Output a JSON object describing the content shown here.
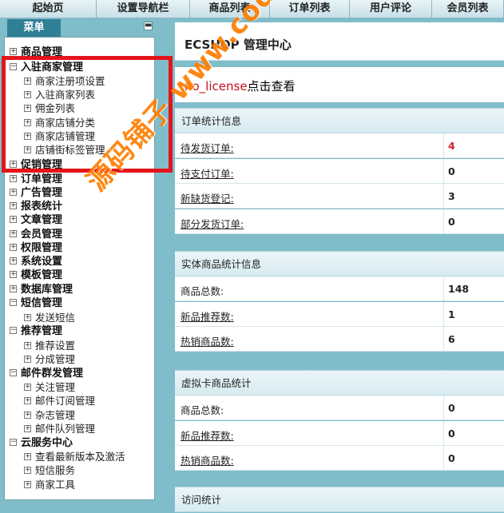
{
  "topnav": {
    "tabs": [
      {
        "label": "起始页",
        "w": 121
      },
      {
        "label": "设置导航栏",
        "w": 117
      },
      {
        "label": "商品列表",
        "w": 100
      },
      {
        "label": "订单列表",
        "w": 100
      },
      {
        "label": "用户评论",
        "w": 103
      },
      {
        "label": "会员列表",
        "w": 90
      }
    ]
  },
  "menu": {
    "tab_label": "菜单",
    "collapse_glyph": "▬",
    "items": [
      {
        "label": "商品管理",
        "type": "group",
        "box": "plus"
      },
      {
        "label": "入驻商家管理",
        "type": "group",
        "box": "minus"
      },
      {
        "label": "商家注册项设置",
        "type": "child"
      },
      {
        "label": "入驻商家列表",
        "type": "child"
      },
      {
        "label": "佣金列表",
        "type": "child"
      },
      {
        "label": "商家店铺分类",
        "type": "child"
      },
      {
        "label": "商家店铺管理",
        "type": "child"
      },
      {
        "label": "店铺街标签管理",
        "type": "child"
      },
      {
        "label": "促销管理",
        "type": "group",
        "box": "plus"
      },
      {
        "label": "订单管理",
        "type": "group",
        "box": "plus"
      },
      {
        "label": "广告管理",
        "type": "group",
        "box": "plus"
      },
      {
        "label": "报表统计",
        "type": "group",
        "box": "plus"
      },
      {
        "label": "文章管理",
        "type": "group",
        "box": "plus"
      },
      {
        "label": "会员管理",
        "type": "group",
        "box": "plus"
      },
      {
        "label": "权限管理",
        "type": "group",
        "box": "plus"
      },
      {
        "label": "系统设置",
        "type": "group",
        "box": "plus"
      },
      {
        "label": "模板管理",
        "type": "group",
        "box": "plus"
      },
      {
        "label": "数据库管理",
        "type": "group",
        "box": "plus"
      },
      {
        "label": "短信管理",
        "type": "group",
        "box": "minus"
      },
      {
        "label": "发送短信",
        "type": "child"
      },
      {
        "label": "推荐管理",
        "type": "group",
        "box": "minus"
      },
      {
        "label": "推荐设置",
        "type": "child"
      },
      {
        "label": "分成管理",
        "type": "child"
      },
      {
        "label": "邮件群发管理",
        "type": "group",
        "box": "minus"
      },
      {
        "label": "关注管理",
        "type": "child"
      },
      {
        "label": "邮件订阅管理",
        "type": "child"
      },
      {
        "label": "杂志管理",
        "type": "child"
      },
      {
        "label": "邮件队列管理",
        "type": "child"
      },
      {
        "label": "云服务中心",
        "type": "group",
        "box": "minus"
      },
      {
        "label": "查看最新版本及激活",
        "type": "child"
      },
      {
        "label": "短信服务",
        "type": "child"
      },
      {
        "label": "商家工具",
        "type": "child"
      }
    ]
  },
  "header": {
    "title": "ECSHOP 管理中心"
  },
  "notice": {
    "code": "no_license",
    "text": "点击查看"
  },
  "sections": [
    {
      "title": "订单统计信息",
      "rows": [
        {
          "label": "待发货订单:",
          "value": "4",
          "red": true
        },
        {
          "label": "待支付订单:",
          "value": "0"
        },
        {
          "label": "新缺货登记:",
          "value": "3"
        },
        {
          "label": "部分发货订单:",
          "value": "0"
        }
      ]
    },
    {
      "title": "实体商品统计信息",
      "rows": [
        {
          "label": "商品总数:",
          "value": "148",
          "plain": true
        },
        {
          "label": "新品推荐数:",
          "value": "1"
        },
        {
          "label": "热销商品数:",
          "value": "6"
        }
      ]
    },
    {
      "title": "虚拟卡商品统计",
      "rows": [
        {
          "label": "商品总数:",
          "value": "0",
          "plain": true
        },
        {
          "label": "新品推荐数:",
          "value": "0"
        },
        {
          "label": "热销商品数:",
          "value": "0"
        }
      ]
    },
    {
      "title": "访问统计",
      "rows": []
    }
  ],
  "watermark": "源码铺子 www.codespu.com",
  "colors": {
    "highlight": "#e3141a",
    "accent": "#2f7f95",
    "red_value": "#d0222a",
    "watermark": "#ff7d00"
  }
}
